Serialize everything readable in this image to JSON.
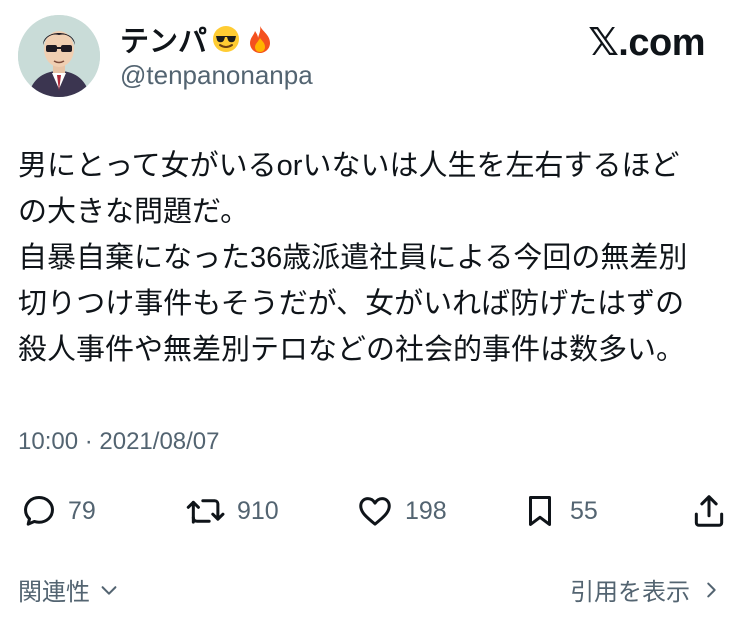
{
  "user": {
    "display_name": "テンパ",
    "name_emojis": [
      "smiling-face-with-sunglasses-icon",
      "fire-icon"
    ],
    "handle": "@tenpanonanpa",
    "avatar_icon": "illustrated-man-avatar"
  },
  "brand": {
    "label": "𝕏.com"
  },
  "tweet": {
    "lines": [
      "男にとって女がいるorいないは人生を左右するほど",
      "の大きな問題だ。",
      "自暴自棄になった36歳派遣社員による今回の無差別",
      "切りつけ事件もそうだが、女がいれば防げたはずの",
      "殺人事件や無差別テロなどの社会的事件は数多い。"
    ],
    "timestamp": "10:00 · 2021/08/07"
  },
  "actions": {
    "reply": {
      "icon": "reply-bubble-icon",
      "count": "79"
    },
    "retweet": {
      "icon": "retweet-icon",
      "count": "910"
    },
    "like": {
      "icon": "heart-icon",
      "count": "198"
    },
    "bookmark": {
      "icon": "bookmark-icon",
      "count": "55"
    },
    "share": {
      "icon": "share-icon"
    }
  },
  "footer": {
    "related_label": "関連性",
    "quote_label": "引用を表示"
  },
  "colors": {
    "text": "#0f1419",
    "secondary": "#536471",
    "background": "#ffffff"
  }
}
